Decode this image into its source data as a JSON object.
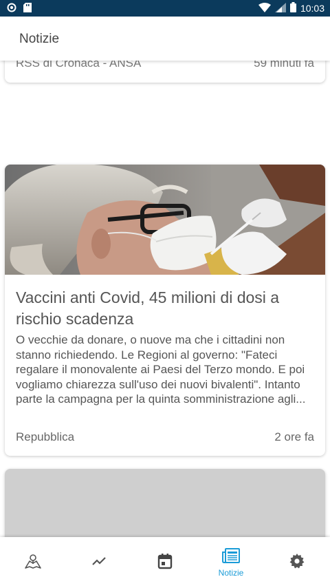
{
  "status_bar": {
    "time": "10:03"
  },
  "app_bar": {
    "title": "Notizie"
  },
  "feed": {
    "previous_card": {
      "source": "RSS di Cronaca  - ANSA",
      "time_ago": "59 minuti fa"
    },
    "main_card": {
      "title": "Vaccini anti Covid, 45 milioni di dosi a rischio scadenza",
      "description": "O vecchie da donare, o nuove ma che i cittadini non stanno richiedendo. Le Regioni al governo: \"Fateci regalare il monovalente ai Paesi del Terzo mondo. E poi vogliamo chiarezza sull'uso dei nuovi bivalenti\". Intanto parte la campagna per la quinta somministrazione agli...",
      "source": "Repubblica",
      "time_ago": "2 ore fa"
    }
  },
  "bottom_nav": {
    "items": [
      {
        "icon": "map-icon",
        "label": ""
      },
      {
        "icon": "trending-icon",
        "label": ""
      },
      {
        "icon": "calendar-icon",
        "label": ""
      },
      {
        "icon": "news-icon",
        "label": "Notizie",
        "active": true
      },
      {
        "icon": "gear-icon",
        "label": ""
      }
    ]
  },
  "colors": {
    "status_bar": "#0b3a5c",
    "accent": "#1a9bd7",
    "text": "#555555"
  }
}
